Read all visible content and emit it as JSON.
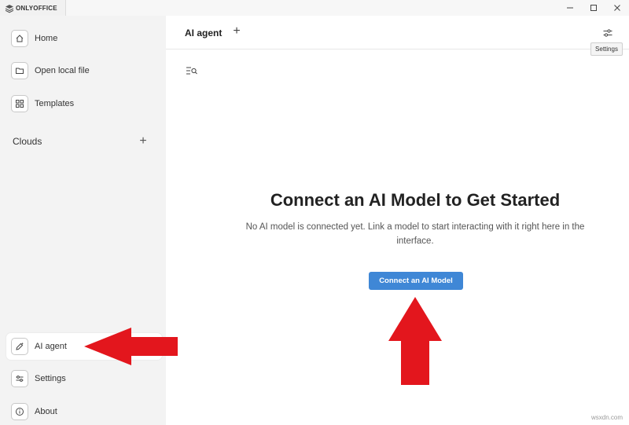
{
  "app": {
    "name": "ONLYOFFICE"
  },
  "window_controls": {
    "minimize": "—",
    "maximize": "☐",
    "close": "✕"
  },
  "sidebar": {
    "items": [
      {
        "label": "Home",
        "icon": "home-icon"
      },
      {
        "label": "Open local file",
        "icon": "folder-icon"
      },
      {
        "label": "Templates",
        "icon": "templates-icon"
      }
    ],
    "clouds_label": "Clouds",
    "clouds_add": "+",
    "bottom_items": [
      {
        "label": "AI agent",
        "icon": "ai-agent-icon",
        "active": true
      },
      {
        "label": "Settings",
        "icon": "settings-sliders-icon"
      },
      {
        "label": "About",
        "icon": "info-icon"
      }
    ]
  },
  "main": {
    "title": "AI agent",
    "new_chat": "+",
    "settings_tooltip": "Settings",
    "heading": "Connect an AI Model to Get Started",
    "description": "No AI model is connected yet. Link a model to start interacting with it right here in the interface.",
    "connect_button": "Connect an AI Model"
  },
  "colors": {
    "accent": "#3f87d6",
    "arrow": "#e3161d",
    "sidebar_bg": "#f3f3f3"
  },
  "watermark": "wsxdn.com"
}
